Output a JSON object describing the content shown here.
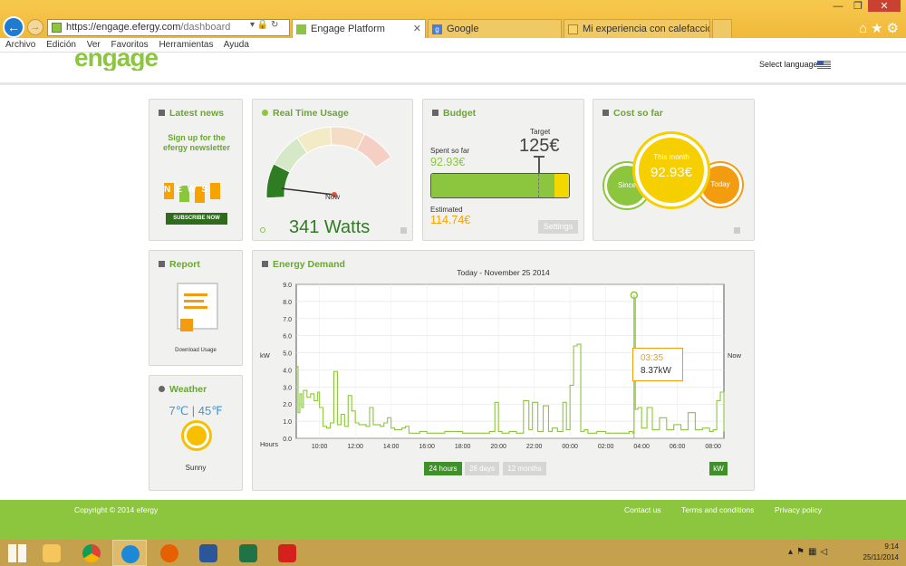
{
  "browser": {
    "url_host": "https://engage.efergy.com",
    "url_path": "/dashboard",
    "tabs": [
      {
        "label": "Engage Platform"
      },
      {
        "label": "Google"
      },
      {
        "label": "Mi experiencia con calefacción..."
      }
    ],
    "menu": [
      "Archivo",
      "Edición",
      "Ver",
      "Favoritos",
      "Herramientas",
      "Ayuda"
    ]
  },
  "header": {
    "logo": "engage",
    "language_label": "Select language"
  },
  "cards": {
    "news": {
      "title": "Latest news",
      "headline": "Sign up for the efergy newsletter",
      "letters": [
        "N",
        "E",
        "W",
        "S"
      ],
      "subscribe": "SUBSCRIBE NOW"
    },
    "realtime": {
      "title": "Real Time Usage",
      "value": "341 Watts",
      "now": "Now",
      "level": 0.08
    },
    "budget": {
      "title": "Budget",
      "spent_label": "Spent so far",
      "spent_value": "92.93€",
      "target_label": "Target",
      "target_value": "125€",
      "estimated_label": "Estimated",
      "estimated_value": "114.74€",
      "settings": "Settings",
      "spent_fraction": 0.743,
      "estimated_fraction": 0.918
    },
    "cost": {
      "title": "Cost so far",
      "since": "Since",
      "month_label": "This month",
      "month_value": "92.93€",
      "today": "Today"
    },
    "report": {
      "title": "Report",
      "download": "Download Usage"
    },
    "weather": {
      "title": "Weather",
      "temps": "7℃ | 45℉",
      "condition": "Sunny"
    },
    "demand": {
      "title": "Energy Demand",
      "tooltip_time": "03:35",
      "tooltip_value": "8.37kW",
      "buttons": {
        "h24": "24 hours",
        "d28": "28 days",
        "m12": "12 months",
        "unit": "kW"
      }
    }
  },
  "chart_data": {
    "type": "line",
    "title": "Today - November 25 2014",
    "ylabel": "kW",
    "xlabel": "Hours",
    "right_label": "Now",
    "ylim": [
      0,
      9
    ],
    "xlim": [
      8.7,
      32.6
    ],
    "y_ticks": [
      "0.0",
      "1.0",
      "2.0",
      "3.0",
      "4.0",
      "5.0",
      "6.0",
      "7.0",
      "8.0",
      "9.0"
    ],
    "x_ticks": [
      {
        "label": "10:00",
        "h": 10
      },
      {
        "label": "12:00",
        "h": 12
      },
      {
        "label": "14:00",
        "h": 14
      },
      {
        "label": "16:00",
        "h": 16
      },
      {
        "label": "18:00",
        "h": 18
      },
      {
        "label": "20:00",
        "h": 20
      },
      {
        "label": "22:00",
        "h": 22
      },
      {
        "label": "00:00",
        "h": 24
      },
      {
        "label": "02:00",
        "h": 26
      },
      {
        "label": "04:00",
        "h": 28
      },
      {
        "label": "06:00",
        "h": 30
      },
      {
        "label": "08:00",
        "h": 32
      }
    ],
    "highlight": {
      "x": 27.58,
      "y": 8.37
    },
    "series": [
      {
        "x": [
          8.7,
          8.8,
          8.9,
          9.0,
          9.1,
          9.3,
          9.5,
          9.7,
          9.9,
          10.0,
          10.2,
          10.4,
          10.6,
          10.8,
          11.0,
          11.2,
          11.4,
          11.6,
          11.8,
          12.0,
          12.2,
          12.4,
          12.6,
          12.8,
          13.0,
          13.2,
          13.4,
          13.6,
          13.8,
          14.0,
          14.2,
          14.4,
          14.6,
          14.8,
          15.0,
          15.3,
          15.6,
          16.0,
          16.5,
          17.0,
          17.5,
          18.0,
          18.5,
          19.0,
          19.5,
          19.8,
          20.0,
          20.2,
          20.6,
          21.0,
          21.4,
          21.7,
          21.9,
          22.2,
          22.5,
          22.8,
          23.0,
          23.3,
          23.6,
          23.8,
          24.0,
          24.2,
          24.4,
          24.6,
          24.8,
          25.0,
          25.5,
          26.0,
          26.5,
          27.0,
          27.3,
          27.5,
          27.58,
          27.65,
          27.8,
          28.0,
          28.3,
          28.6,
          29.0,
          29.4,
          29.8,
          30.2,
          30.6,
          31.0,
          31.4,
          31.8,
          32.0,
          32.2,
          32.4,
          32.6
        ],
        "y": [
          4.2,
          1.5,
          2.6,
          1.8,
          2.8,
          2.4,
          2.6,
          2.2,
          2.7,
          1.8,
          0.7,
          0.6,
          0.9,
          3.9,
          0.8,
          1.4,
          0.7,
          2.5,
          1.6,
          0.9,
          0.8,
          0.8,
          0.7,
          1.8,
          0.8,
          0.8,
          0.7,
          0.9,
          1.2,
          0.6,
          0.5,
          0.5,
          0.6,
          0.7,
          0.3,
          0.3,
          0.4,
          0.3,
          0.3,
          0.4,
          0.4,
          0.3,
          0.3,
          0.3,
          0.4,
          2.1,
          0.4,
          0.3,
          0.4,
          0.3,
          2.2,
          0.5,
          2.1,
          0.4,
          1.9,
          0.4,
          0.6,
          0.4,
          2.1,
          0.5,
          3.1,
          5.4,
          5.5,
          0.4,
          0.5,
          0.3,
          0.4,
          0.3,
          0.3,
          0.3,
          0.4,
          0.3,
          8.37,
          1.7,
          1.8,
          0.6,
          1.8,
          0.5,
          1.2,
          0.5,
          0.8,
          0.5,
          1.5,
          0.5,
          0.6,
          0.4,
          0.5,
          2.2,
          2.7,
          0.4
        ]
      }
    ]
  }
}
